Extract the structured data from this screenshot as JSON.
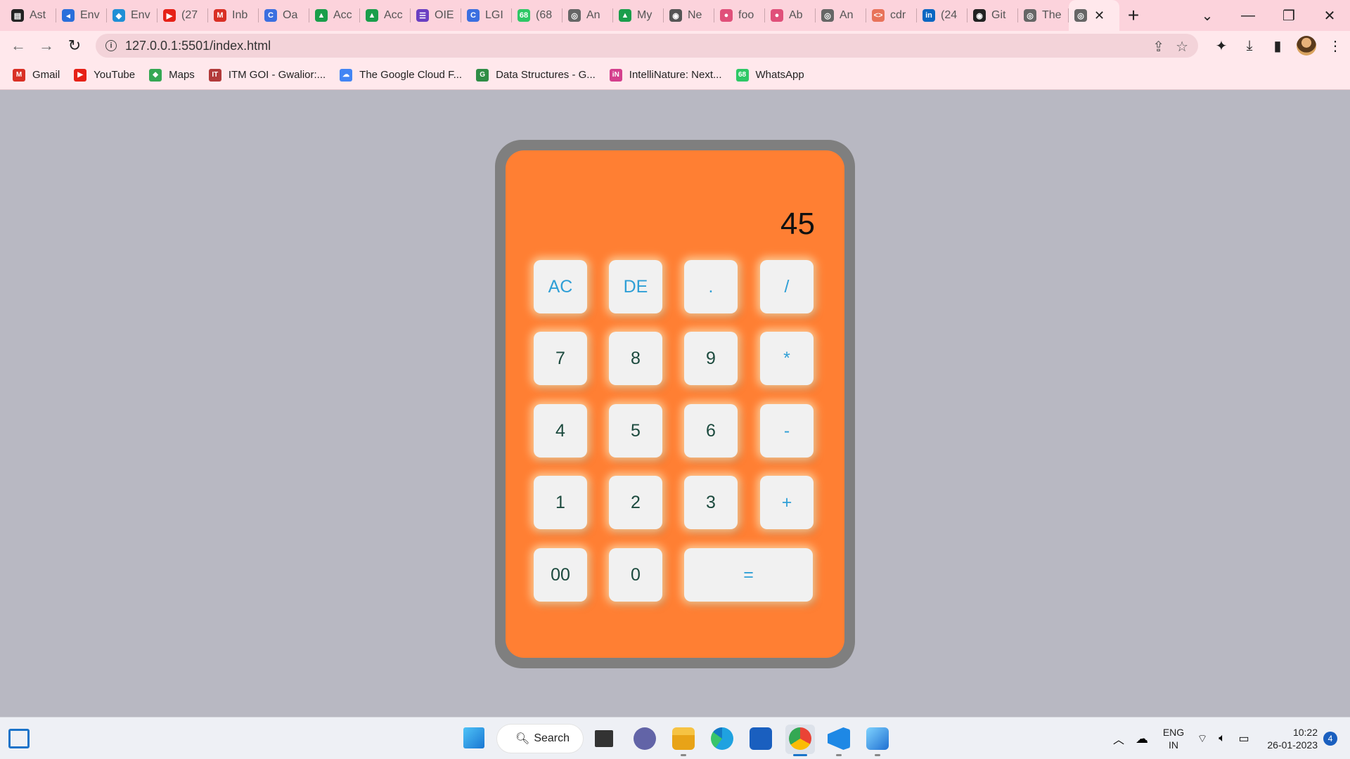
{
  "browser": {
    "tabs": [
      {
        "title": "Ast",
        "color": "#222222",
        "glyph": "▤"
      },
      {
        "title": "Env",
        "color": "#2a6fdb",
        "glyph": "◂"
      },
      {
        "title": "Env",
        "color": "#1f8fd6",
        "glyph": "◆"
      },
      {
        "title": "(27",
        "color": "#e62117",
        "glyph": "▶"
      },
      {
        "title": "Inb",
        "color": "#d93025",
        "glyph": "M"
      },
      {
        "title": "Oa",
        "color": "#3b6fe0",
        "glyph": "C"
      },
      {
        "title": "Acc",
        "color": "#1a9e4b",
        "glyph": "▲"
      },
      {
        "title": "Acc",
        "color": "#1a9e4b",
        "glyph": "▲"
      },
      {
        "title": "OIE",
        "color": "#6a3fc2",
        "glyph": "☰"
      },
      {
        "title": "LGI",
        "color": "#3b6fe0",
        "glyph": "C"
      },
      {
        "title": "(68",
        "color": "#2ec866",
        "glyph": "68"
      },
      {
        "title": "An",
        "color": "#666666",
        "glyph": "◎"
      },
      {
        "title": "My",
        "color": "#1a9e4b",
        "glyph": "▲"
      },
      {
        "title": "Ne",
        "color": "#555555",
        "glyph": "◉"
      },
      {
        "title": "foo",
        "color": "#e0507a",
        "glyph": "●"
      },
      {
        "title": "Ab",
        "color": "#e0507a",
        "glyph": "●"
      },
      {
        "title": "An",
        "color": "#666666",
        "glyph": "◎"
      },
      {
        "title": "cdr",
        "color": "#e8735a",
        "glyph": "<>"
      },
      {
        "title": "(24",
        "color": "#0a66c2",
        "glyph": "in"
      },
      {
        "title": "Git",
        "color": "#222222",
        "glyph": "◉"
      },
      {
        "title": "The",
        "color": "#666666",
        "glyph": "◎"
      }
    ],
    "active_tab": {
      "color": "#666666",
      "glyph": "◎",
      "close": "✕"
    },
    "new_tab": "+",
    "url": "127.0.0.1:5501/index.html",
    "bookmarks": [
      {
        "label": "Gmail",
        "color": "#d93025",
        "glyph": "M"
      },
      {
        "label": "YouTube",
        "color": "#e62117",
        "glyph": "▶"
      },
      {
        "label": "Maps",
        "color": "#34a853",
        "glyph": "◆"
      },
      {
        "label": "ITM GOI - Gwalior:...",
        "color": "#b23a3a",
        "glyph": "IT"
      },
      {
        "label": "The Google Cloud F...",
        "color": "#4285f4",
        "glyph": "☁"
      },
      {
        "label": "Data Structures - G...",
        "color": "#2f8d46",
        "glyph": "G"
      },
      {
        "label": "IntelliNature: Next...",
        "color": "#d43f8d",
        "glyph": "iN"
      },
      {
        "label": "WhatsApp",
        "color": "#2ec866",
        "glyph": "68"
      }
    ]
  },
  "calculator": {
    "display": "45",
    "keys": [
      {
        "label": "AC",
        "type": "op"
      },
      {
        "label": "DE",
        "type": "op"
      },
      {
        "label": ".",
        "type": "op"
      },
      {
        "label": "/",
        "type": "op"
      },
      {
        "label": "7",
        "type": "num"
      },
      {
        "label": "8",
        "type": "num"
      },
      {
        "label": "9",
        "type": "num"
      },
      {
        "label": "*",
        "type": "op"
      },
      {
        "label": "4",
        "type": "num"
      },
      {
        "label": "5",
        "type": "num"
      },
      {
        "label": "6",
        "type": "num"
      },
      {
        "label": "-",
        "type": "op"
      },
      {
        "label": "1",
        "type": "num"
      },
      {
        "label": "2",
        "type": "num"
      },
      {
        "label": "3",
        "type": "num"
      },
      {
        "label": "+",
        "type": "op"
      },
      {
        "label": "00",
        "type": "num"
      },
      {
        "label": "0",
        "type": "num"
      },
      {
        "label": "=",
        "type": "op"
      }
    ]
  },
  "taskbar": {
    "search_label": "Search",
    "language": "ENG",
    "region": "IN",
    "time": "10:22",
    "date": "26-01-2023",
    "notifications": "4"
  }
}
